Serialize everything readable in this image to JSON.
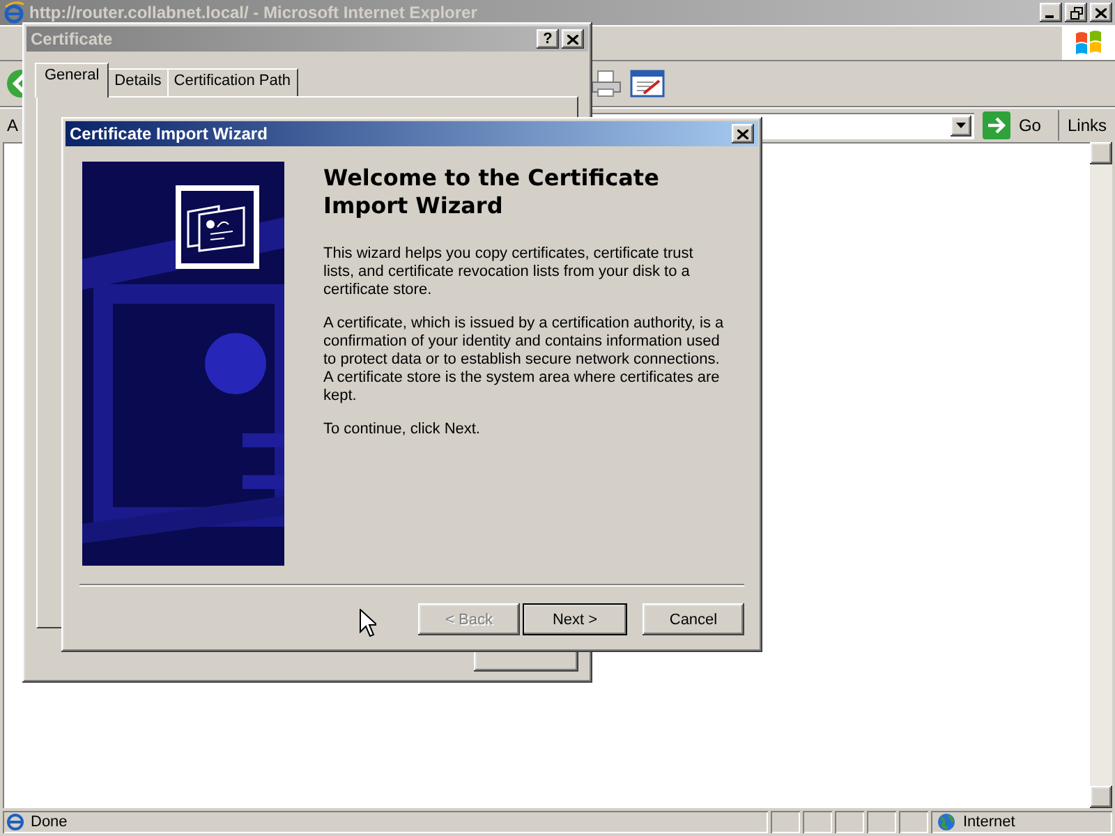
{
  "browser": {
    "title": "http://router.collabnet.local/ - Microsoft Internet Explorer",
    "address_label": "A",
    "go_button": "Go",
    "links": "Links",
    "status_bar": {
      "text": "Done",
      "zone": "Internet"
    }
  },
  "certificate_dialog": {
    "title": "Certificate",
    "help_button": "?",
    "tabs": [
      {
        "label": "General",
        "selected": true
      },
      {
        "label": "Details",
        "selected": false
      },
      {
        "label": "Certification Path",
        "selected": false
      }
    ]
  },
  "wizard": {
    "title": "Certificate Import Wizard",
    "heading": "Welcome to the Certificate Import Wizard",
    "paragraphs": [
      "This wizard helps you copy certificates, certificate trust lists, and certificate revocation lists from your disk to a certificate store.",
      "A certificate, which is issued by a certification authority, is a confirmation of your identity and contains information used to protect data or to establish secure network connections. A certificate store is the system area where certificates are kept.",
      "To continue, click Next."
    ],
    "buttons": [
      {
        "label": "< Back",
        "disabled": true,
        "default": false
      },
      {
        "label": "Next >",
        "disabled": false,
        "default": true
      },
      {
        "label": "Cancel",
        "disabled": false,
        "default": false
      }
    ]
  }
}
